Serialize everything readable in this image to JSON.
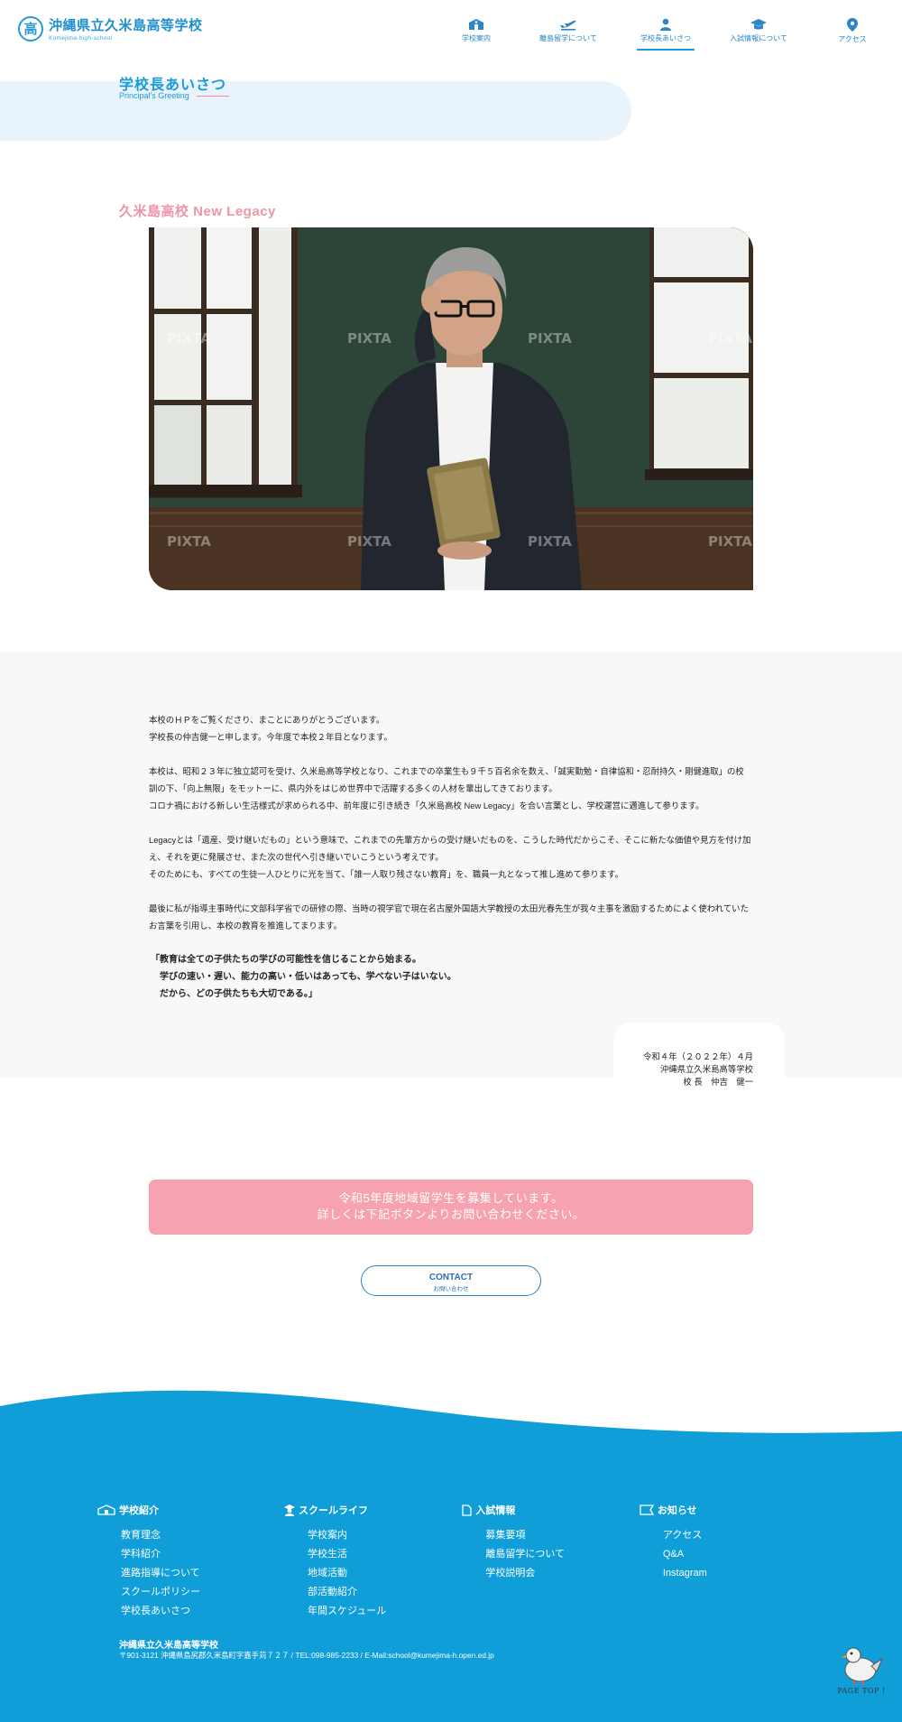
{
  "header": {
    "logo_mark": "高",
    "school_name": "沖縄県立久米島高等学校",
    "school_sub": "Kumejima-high-school",
    "nav": [
      {
        "label": "学校案内",
        "icon": "school-building-icon"
      },
      {
        "label": "離島留学について",
        "icon": "airplane-icon"
      },
      {
        "label": "学校長あいさつ",
        "icon": "person-icon",
        "active": true
      },
      {
        "label": "入試情報について",
        "icon": "graduation-cap-icon"
      },
      {
        "label": "アクセス",
        "icon": "map-pin-icon"
      }
    ]
  },
  "page": {
    "title": "学校長あいさつ",
    "subtitle": "Principal's Greeting"
  },
  "section": {
    "heading": "久米島高校 New Legacy"
  },
  "photo": {
    "watermark": "PIXTA"
  },
  "message": {
    "p1": [
      "本校のＨＰをご覧くださり、まことにありがとうございます。",
      "学校長の仲吉健一と申します。今年度で本校２年目となります。"
    ],
    "p2": [
      "本校は、昭和２３年に独立認可を受け、久米島高等学校となり、これまでの卒業生も９千５百名余を数え、「誠実勤勉・自律協和・忍耐持久・剛健進取」の校",
      "訓の下、「向上無限」をモットーに、県内外をはじめ世界中で活躍する多くの人材を輩出してきております。",
      "コロナ禍における新しい生活様式が求められる中、前年度に引き続き「久米島高校 New Legacy」を合い言葉とし、学校運営に邁進して参ります。"
    ],
    "p3": [
      "Legacyとは「遺産、受け継いだもの」という意味で、これまでの先輩方からの受け継いだものを、こうした時代だからこそ、そこに新たな価値や見方を付け加",
      "え、それを更に発展させ、また次の世代へ引き継いでいこうという考えです。",
      "そのためにも、すべての生徒一人ひとりに光を当て、「誰一人取り残さない教育」を、職員一丸となって推し進めて参ります。"
    ],
    "p4": [
      "最後に私が指導主事時代に文部科学省での研修の際、当時の視学官で現在名古屋外国語大学教授の太田光春先生が我々主事を激励するためによく使われていた",
      "お言葉を引用し、本校の教育を推進してまります。"
    ],
    "quote": [
      "「教育は全ての子供たちの学びの可能性を信じることから始まる。",
      "学びの速い・遅い、能力の高い・低いはあっても、学べない子はいない。",
      "だから、どの子供たちも大切である。」"
    ]
  },
  "signature": {
    "date": "令和４年（２０２２年）４月",
    "school": "沖縄県立久米島高等学校",
    "name": "校 長　仲吉　健一"
  },
  "banner": {
    "line1": "令和5年度地域留学生を募集しています。",
    "line2": "詳しくは下記ボタンよりお問い合わせください。"
  },
  "contact": {
    "label": "CONTACT",
    "sub": "お問い合わせ"
  },
  "footer": {
    "columns": [
      {
        "heading": "学校紹介",
        "icon": "school-icon",
        "items": [
          "教育理念",
          "学科紹介",
          "進路指導について",
          "スクールポリシー",
          "学校長あいさつ"
        ]
      },
      {
        "heading": "スクールライフ",
        "icon": "student-icon",
        "items": [
          "学校案内",
          "学校生活",
          "地域活動",
          "部活動紹介",
          "年間スケジュール"
        ]
      },
      {
        "heading": "入試情報",
        "icon": "document-icon",
        "items": [
          "募集要項",
          "離島留学について",
          "学校説明会"
        ]
      },
      {
        "heading": "お知らせ",
        "icon": "flag-icon",
        "items": [
          "アクセス",
          "Q&A",
          "Instagram"
        ]
      }
    ],
    "school": "沖縄県立久米島高等学校",
    "address": "〒901-3121 沖縄県島尻郡久米島町字嘉手苅７２７ / TEL:098-985-2233 / E-Mail:school@kumejima-h.open.ed.jp",
    "pagetop": "PAGE TOP !"
  },
  "colors": {
    "accent_blue": "#1a9ad8",
    "footer_blue": "#0f9ed8",
    "pink": "#f095a6",
    "banner_pink": "#f6a2b1"
  }
}
